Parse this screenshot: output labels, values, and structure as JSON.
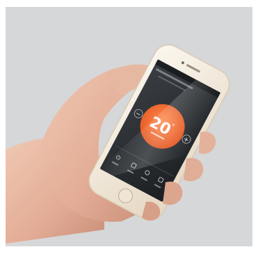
{
  "photo": {
    "subject": "hand-holding-smartphone",
    "colors": {
      "backdrop": "#d6d7d8",
      "phone_body": "#f3ecdf",
      "screen_bg": "#2b2f33",
      "accent_dial": "#f26a2e",
      "skin": "#e8b9a3"
    }
  },
  "app": {
    "temperature_value": "20",
    "temperature_unit": "°",
    "minus_label": "−",
    "plus_label": "+",
    "power_label": "⏻"
  }
}
